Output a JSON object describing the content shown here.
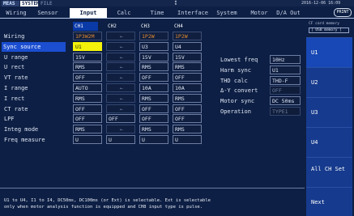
{
  "status": {
    "mode_meas": "MEAS",
    "mode_sys": "SYSTEM",
    "mode_file": "FILE",
    "datetime": "2016-12-06 16:09"
  },
  "tabs": {
    "wiring": "Wiring",
    "sensor": "Sensor",
    "input": "Input",
    "calc": "Calc",
    "time": "Time",
    "interface": "Interface",
    "system": "System",
    "motor": "Motor",
    "da_out": "D/A Out",
    "print": "PRINT"
  },
  "channels": [
    "CH1",
    "CH2",
    "CH3",
    "CH4"
  ],
  "rows": [
    {
      "label": "Wiring",
      "cells": [
        "1P3W2M",
        "←",
        "1P2W",
        "1P2W"
      ],
      "styles": [
        "orange",
        "dash",
        "orange",
        "orange"
      ]
    },
    {
      "label": "Sync source",
      "cells": [
        "U1",
        "←",
        "U3",
        "U4"
      ],
      "styles": [
        "yellow",
        "dash",
        "",
        ""
      ]
    },
    {
      "label": "U range",
      "cells": [
        "15V",
        "←",
        "15V",
        "15V"
      ],
      "styles": [
        "",
        "dash",
        "",
        ""
      ]
    },
    {
      "label": "U rect",
      "cells": [
        "RMS",
        "←",
        "RMS",
        "RMS"
      ],
      "styles": [
        "",
        "dash",
        "",
        ""
      ]
    },
    {
      "label": "VT rate",
      "cells": [
        "OFF",
        "←",
        "OFF",
        "OFF"
      ],
      "styles": [
        "",
        "dash",
        "",
        ""
      ]
    },
    {
      "label": "I range",
      "cells": [
        "AUTO",
        "←",
        "10A",
        "10A"
      ],
      "styles": [
        "",
        "dash",
        "",
        ""
      ]
    },
    {
      "label": "I rect",
      "cells": [
        "RMS",
        "←",
        "RMS",
        "RMS"
      ],
      "styles": [
        "",
        "dash",
        "",
        ""
      ]
    },
    {
      "label": "CT rate",
      "cells": [
        "OFF",
        "←",
        "OFF",
        "OFF"
      ],
      "styles": [
        "",
        "dash",
        "",
        ""
      ]
    },
    {
      "label": "LPF",
      "cells": [
        "OFF",
        "OFF",
        "OFF",
        "OFF"
      ],
      "styles": [
        "",
        "",
        "",
        ""
      ]
    },
    {
      "label": "Integ mode",
      "cells": [
        "RMS",
        "←",
        "RMS",
        "RMS"
      ],
      "styles": [
        "",
        "dash",
        "",
        ""
      ]
    },
    {
      "label": "Freq measure",
      "cells": [
        "U",
        "U",
        "U",
        "U"
      ],
      "styles": [
        "",
        "",
        "",
        ""
      ]
    }
  ],
  "settings": [
    {
      "label": "Lowest freq",
      "value": "10Hz",
      "style": ""
    },
    {
      "label": "Harm sync",
      "value": "U1",
      "style": ""
    },
    {
      "label": "THD calc",
      "value": "THD-F",
      "style": ""
    },
    {
      "label": "Δ-Y convert",
      "value": "OFF",
      "style": "dim"
    },
    {
      "label": "Motor sync",
      "value": "DC 50ms",
      "style": ""
    },
    {
      "label": "Operation",
      "value": "TYPE1",
      "style": "dim"
    }
  ],
  "usb": {
    "line1": "CF card memory",
    "line2": "[ USB  memory ]"
  },
  "fkeys": [
    "U1",
    "U2",
    "U3",
    "U4",
    "All CH Set",
    "Next"
  ],
  "info": {
    "line1": "U1 to U4, I1 to I4, DC50ms, DC100ms (or Ext) is selectable. Ext is selectable",
    "line2": "only when motor analysis function is equipped and CH8 input type is pulse."
  }
}
